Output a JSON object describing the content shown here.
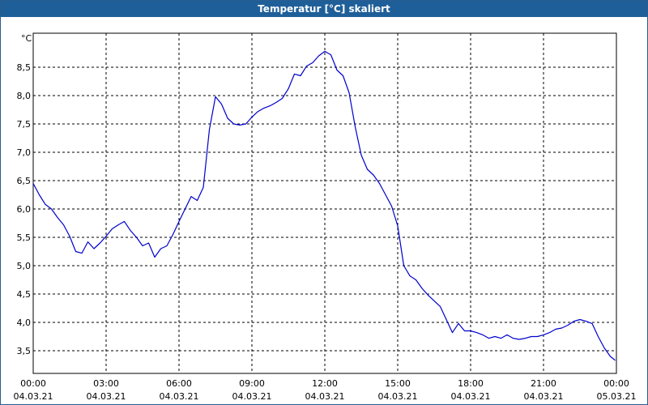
{
  "window": {
    "title": "Temperatur [°C] skaliert"
  },
  "chart_data": {
    "type": "line",
    "title": "Temperatur [°C] skaliert",
    "ylabel": "°C",
    "xlabel": "",
    "ylim": [
      3.1,
      9.1
    ],
    "xlim_hours": [
      0,
      24
    ],
    "grid": true,
    "line_color": "#0000cc",
    "y_ticks": [
      "3,5",
      "4,0",
      "4,5",
      "5,0",
      "5,5",
      "6,0",
      "6,5",
      "7,0",
      "7,5",
      "8,0",
      "8,5"
    ],
    "y_tick_values": [
      3.5,
      4.0,
      4.5,
      5.0,
      5.5,
      6.0,
      6.5,
      7.0,
      7.5,
      8.0,
      8.5
    ],
    "x_ticks": [
      {
        "time": "00:00",
        "date": "04.03.21"
      },
      {
        "time": "03:00",
        "date": "04.03.21"
      },
      {
        "time": "06:00",
        "date": "04.03.21"
      },
      {
        "time": "09:00",
        "date": "04.03.21"
      },
      {
        "time": "12:00",
        "date": "04.03.21"
      },
      {
        "time": "15:00",
        "date": "04.03.21"
      },
      {
        "time": "18:00",
        "date": "04.03.21"
      },
      {
        "time": "21:00",
        "date": "04.03.21"
      },
      {
        "time": "00:00",
        "date": "05.03.21"
      }
    ],
    "x_tick_hours": [
      0,
      3,
      6,
      9,
      12,
      15,
      18,
      21,
      24
    ],
    "series": [
      {
        "x_hours": [
          0.0,
          0.25,
          0.5,
          0.75,
          1.0,
          1.25,
          1.5,
          1.75,
          2.0,
          2.25,
          2.5,
          2.75,
          3.0,
          3.25,
          3.5,
          3.75,
          4.0,
          4.25,
          4.5,
          4.75,
          5.0,
          5.25,
          5.5,
          5.75,
          6.0,
          6.25,
          6.5,
          6.75,
          7.0,
          7.25,
          7.5,
          7.75,
          8.0,
          8.25,
          8.5,
          8.75,
          9.0,
          9.25,
          9.5,
          9.75,
          10.0,
          10.25,
          10.5,
          10.75,
          11.0,
          11.25,
          11.5,
          11.75,
          12.0,
          12.25,
          12.5,
          12.75,
          13.0,
          13.25,
          13.5,
          13.75,
          14.0,
          14.25,
          14.5,
          14.75,
          15.0,
          15.25,
          15.5,
          15.75,
          16.0,
          16.25,
          16.5,
          16.75,
          17.0,
          17.25,
          17.5,
          17.75,
          18.0,
          18.25,
          18.5,
          18.75,
          19.0,
          19.25,
          19.5,
          19.75,
          20.0,
          20.25,
          20.5,
          20.75,
          21.0,
          21.25,
          21.5,
          21.75,
          22.0,
          22.25,
          22.5,
          22.75,
          23.0,
          23.25,
          23.5,
          23.75,
          23.95
        ],
        "values": [
          6.45,
          6.25,
          6.08,
          6.0,
          5.85,
          5.72,
          5.52,
          5.25,
          5.22,
          5.42,
          5.3,
          5.4,
          5.52,
          5.65,
          5.72,
          5.78,
          5.62,
          5.5,
          5.35,
          5.4,
          5.15,
          5.3,
          5.35,
          5.55,
          5.78,
          6.0,
          6.22,
          6.15,
          6.38,
          7.4,
          7.98,
          7.85,
          7.6,
          7.5,
          7.48,
          7.5,
          7.62,
          7.72,
          7.78,
          7.82,
          7.88,
          7.95,
          8.12,
          8.38,
          8.35,
          8.52,
          8.58,
          8.7,
          8.78,
          8.72,
          8.45,
          8.35,
          8.05,
          7.45,
          6.95,
          6.7,
          6.6,
          6.45,
          6.25,
          6.05,
          5.7,
          5.0,
          4.82,
          4.75,
          4.6,
          4.48,
          4.38,
          4.28,
          4.05,
          3.82,
          3.98,
          3.85,
          3.85,
          3.82,
          3.78,
          3.72,
          3.75,
          3.72,
          3.78,
          3.72,
          3.7,
          3.72,
          3.75,
          3.75,
          3.78,
          3.82,
          3.88,
          3.9,
          3.95,
          4.02,
          4.05,
          4.02,
          3.98,
          3.75,
          3.55,
          3.4,
          3.33
        ]
      }
    ]
  }
}
